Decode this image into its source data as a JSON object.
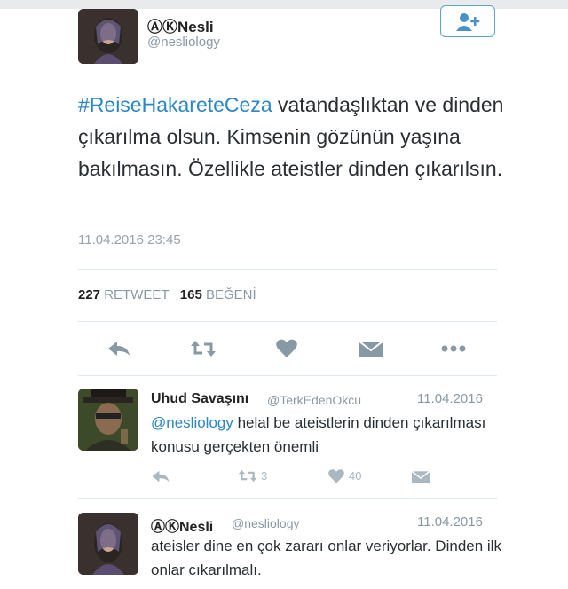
{
  "tweet": {
    "author_name": "ⒶⓀNesli",
    "author_handle": "@nesliology",
    "hashtag": "#ReiseHakareteCeza",
    "text_rest": " vatandaşlıktan ve dinden çıkarılma olsun. Kimsenin gözünün yaşına bakılmasın. Özellikle ateistler dinden çıkarılsın.",
    "timestamp": "11.04.2016 23:45",
    "retweet_count": "227",
    "retweet_label": "RETWEET",
    "like_count": "165",
    "like_label": "BEĞENİ"
  },
  "replies": [
    {
      "author_name": "Uhud Savaşını",
      "author_handle": "@TerkEdenOkcu",
      "date": "11.04.2016",
      "mention": "@nesliology",
      "text": " helal be ateistlerin dinden çıkarılması konusu gerçekten önemli",
      "retweet_count": "3",
      "like_count": "40"
    },
    {
      "author_name": "ⒶⓀNesli",
      "author_handle": "@nesliology",
      "date": "11.04.2016",
      "text": "ateisler dine en çok zararı onlar veriyorlar. Dinden ilk onlar cıkarılmalı."
    }
  ],
  "icons": {
    "follow": "add-user-icon",
    "reply": "reply-icon",
    "retweet": "retweet-icon",
    "like": "heart-icon",
    "message": "envelope-icon",
    "more": "more-icon"
  },
  "colors": {
    "link": "#2a87c8",
    "muted": "#8899a6",
    "icon": "#aab8c2"
  }
}
